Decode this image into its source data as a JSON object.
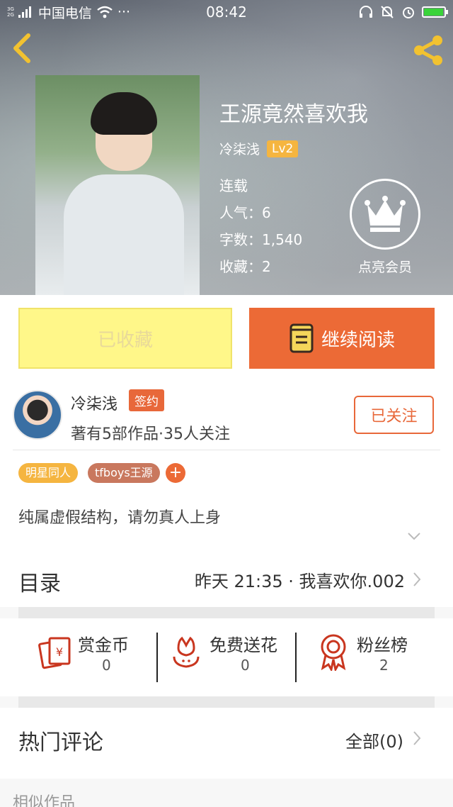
{
  "status_bar": {
    "network_tag_top": "3G",
    "network_tag_bottom": "2G",
    "carrier": "中国电信",
    "more": "···",
    "time": "08:42"
  },
  "book": {
    "title": "王源竟然喜欢我",
    "author": "冷柒浅",
    "author_level": "Lv2",
    "status": "连载",
    "popularity_label": "人气：",
    "popularity": "6",
    "words_label": "字数：",
    "words": "1,540",
    "favorites_label": "收藏：",
    "favorites": "2"
  },
  "vip": {
    "label": "点亮会员"
  },
  "actions": {
    "favorited_label": "已收藏",
    "continue_label": "继续阅读"
  },
  "author_card": {
    "name": "冷柒浅",
    "sign_badge": "签约",
    "info": "著有5部作品·35人关注",
    "follow_label": "已关注"
  },
  "tags": [
    "明星同人",
    "tfboys王源"
  ],
  "tag_add": "+",
  "description": "纯属虚假结构，请勿真人上身",
  "catalog": {
    "title": "目录",
    "latest": "昨天 21:35 · 我喜欢你.002"
  },
  "rewards": [
    {
      "label": "赏金币",
      "value": "0"
    },
    {
      "label": "免费送花",
      "value": "0"
    },
    {
      "label": "粉丝榜",
      "value": "2"
    }
  ],
  "comments": {
    "title": "热门评论",
    "all_label": "全部(0)"
  },
  "similar": {
    "title": "相似作品"
  },
  "colors": {
    "accent": "#ec6a36",
    "favorite_bg": "#fff789",
    "level_badge": "#f5b540",
    "back_arrow": "#f2c230"
  }
}
